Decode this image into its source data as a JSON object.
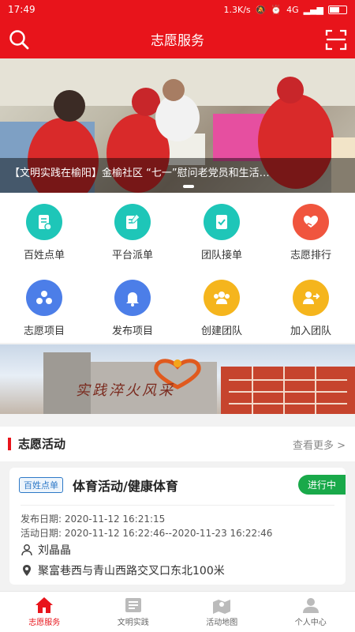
{
  "status_bar": {
    "time": "17:49",
    "network_speed": "1.3K/s",
    "network_type": "4G"
  },
  "app_bar": {
    "title": "志愿服务",
    "left_icon": "search-icon",
    "right_icon": "scan-icon"
  },
  "banner": {
    "caption": "【文明实践在榆阳】金榆社区 “七一”慰问老党员和生活…"
  },
  "grid": {
    "items": [
      {
        "label": "百姓点单",
        "icon": "order-form-icon",
        "color": "#1ec6b8"
      },
      {
        "label": "平台派单",
        "icon": "dispatch-icon",
        "color": "#1ec6b8"
      },
      {
        "label": "团队接单",
        "icon": "accept-order-icon",
        "color": "#1ec6b8"
      },
      {
        "label": "志愿排行",
        "icon": "heart-hand-icon",
        "color": "#f0553e"
      },
      {
        "label": "志愿项目",
        "icon": "project-icon",
        "color": "#4c7ee8"
      },
      {
        "label": "发布项目",
        "icon": "bell-icon",
        "color": "#4c7ee8"
      },
      {
        "label": "创建团队",
        "icon": "team-icon",
        "color": "#f5b51d"
      },
      {
        "label": "加入团队",
        "icon": "join-team-icon",
        "color": "#f5b51d"
      }
    ]
  },
  "promo": {
    "slogan": "实践淬火风采"
  },
  "section": {
    "title": "志愿活动",
    "more": "查看更多 >"
  },
  "activity": {
    "tag": "百姓点单",
    "title": "体育活动/健康体育",
    "status": "进行中",
    "publish_date": "发布日期: 2020-11-12 16:21:15",
    "activity_date": "活动日期: 2020-11-12 16:22:46--2020-11-23 16:22:46",
    "person": "刘晶晶",
    "location": "聚富巷西与青山西路交叉口东北100米"
  },
  "tab_bar": {
    "tabs": [
      {
        "label": "志愿服务",
        "icon": "home-icon",
        "active": true
      },
      {
        "label": "文明实践",
        "icon": "news-icon",
        "active": false
      },
      {
        "label": "活动地图",
        "icon": "map-icon",
        "active": false
      },
      {
        "label": "个人中心",
        "icon": "user-icon",
        "active": false
      }
    ]
  },
  "colors": {
    "brand_red": "#e8141b",
    "status_green": "#19a94a",
    "tag_blue": "#2d79c7"
  }
}
